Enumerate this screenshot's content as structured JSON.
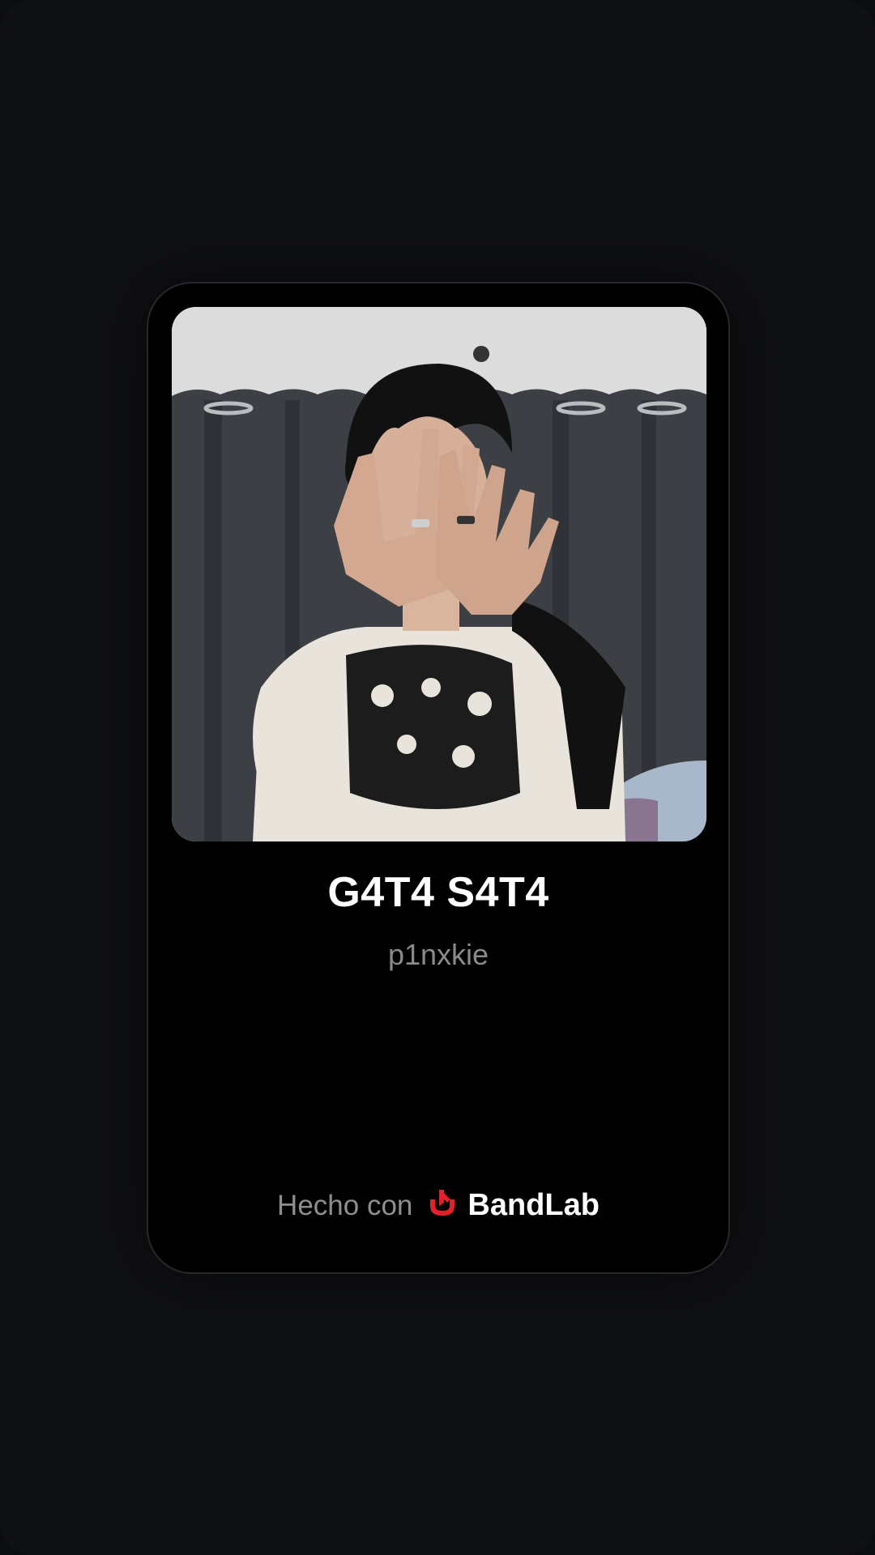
{
  "track": {
    "title": "G4T4 S4T4",
    "artist": "p1nxkie"
  },
  "cover": {
    "alt": "cover-art"
  },
  "footer": {
    "made_with": "Hecho con",
    "brand": "BandLab",
    "brand_color": "#e4212b"
  }
}
